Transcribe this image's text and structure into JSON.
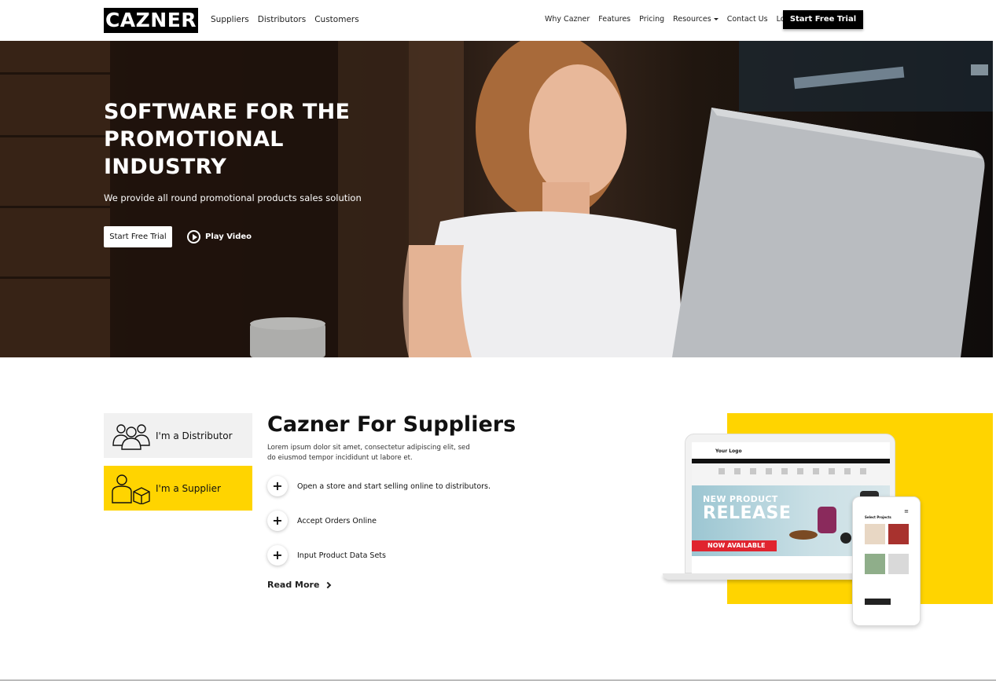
{
  "nav": {
    "logo": "CAZNER",
    "left_links": [
      "Suppliers",
      "Distributors",
      "Customers"
    ],
    "right_links": [
      "Why Cazner",
      "Features",
      "Pricing",
      "Resources",
      "Contact Us",
      "Login"
    ],
    "cta": "Start Free Trial"
  },
  "hero": {
    "title": "SOFTWARE FOR THE PROMOTIONAL INDUSTRY",
    "subtitle": "We provide all round promotional products sales solution",
    "cta": "Start Free Trial",
    "play": "Play Video"
  },
  "roles": {
    "distributor": "I'm a Distributor",
    "supplier": "I'm a Supplier",
    "active": "supplier"
  },
  "section": {
    "title": "Cazner For Suppliers",
    "description": "Lorem ipsum dolor sit amet, consectetur adipiscing elit, sed do eiusmod tempor incididunt ut labore et.",
    "features": [
      "Open a store and start selling online to distributors.",
      "Accept Orders Online",
      "Input Product Data Sets"
    ],
    "read_more": "Read More"
  },
  "mockup": {
    "store_logo": "Your Logo",
    "banner_top": "NEW PRODUCT",
    "banner_main": "RELEASE",
    "banner_cta": "NOW AVAILABLE",
    "phone_title": "Select Projects"
  },
  "colors": {
    "accent": "#ffd400",
    "dark": "#000000",
    "banner_red": "#e0242f"
  },
  "icons": [
    "group-icon",
    "supplier-box-icon",
    "play-icon",
    "plus-icon",
    "chevron-right-icon",
    "caret-down-icon"
  ]
}
